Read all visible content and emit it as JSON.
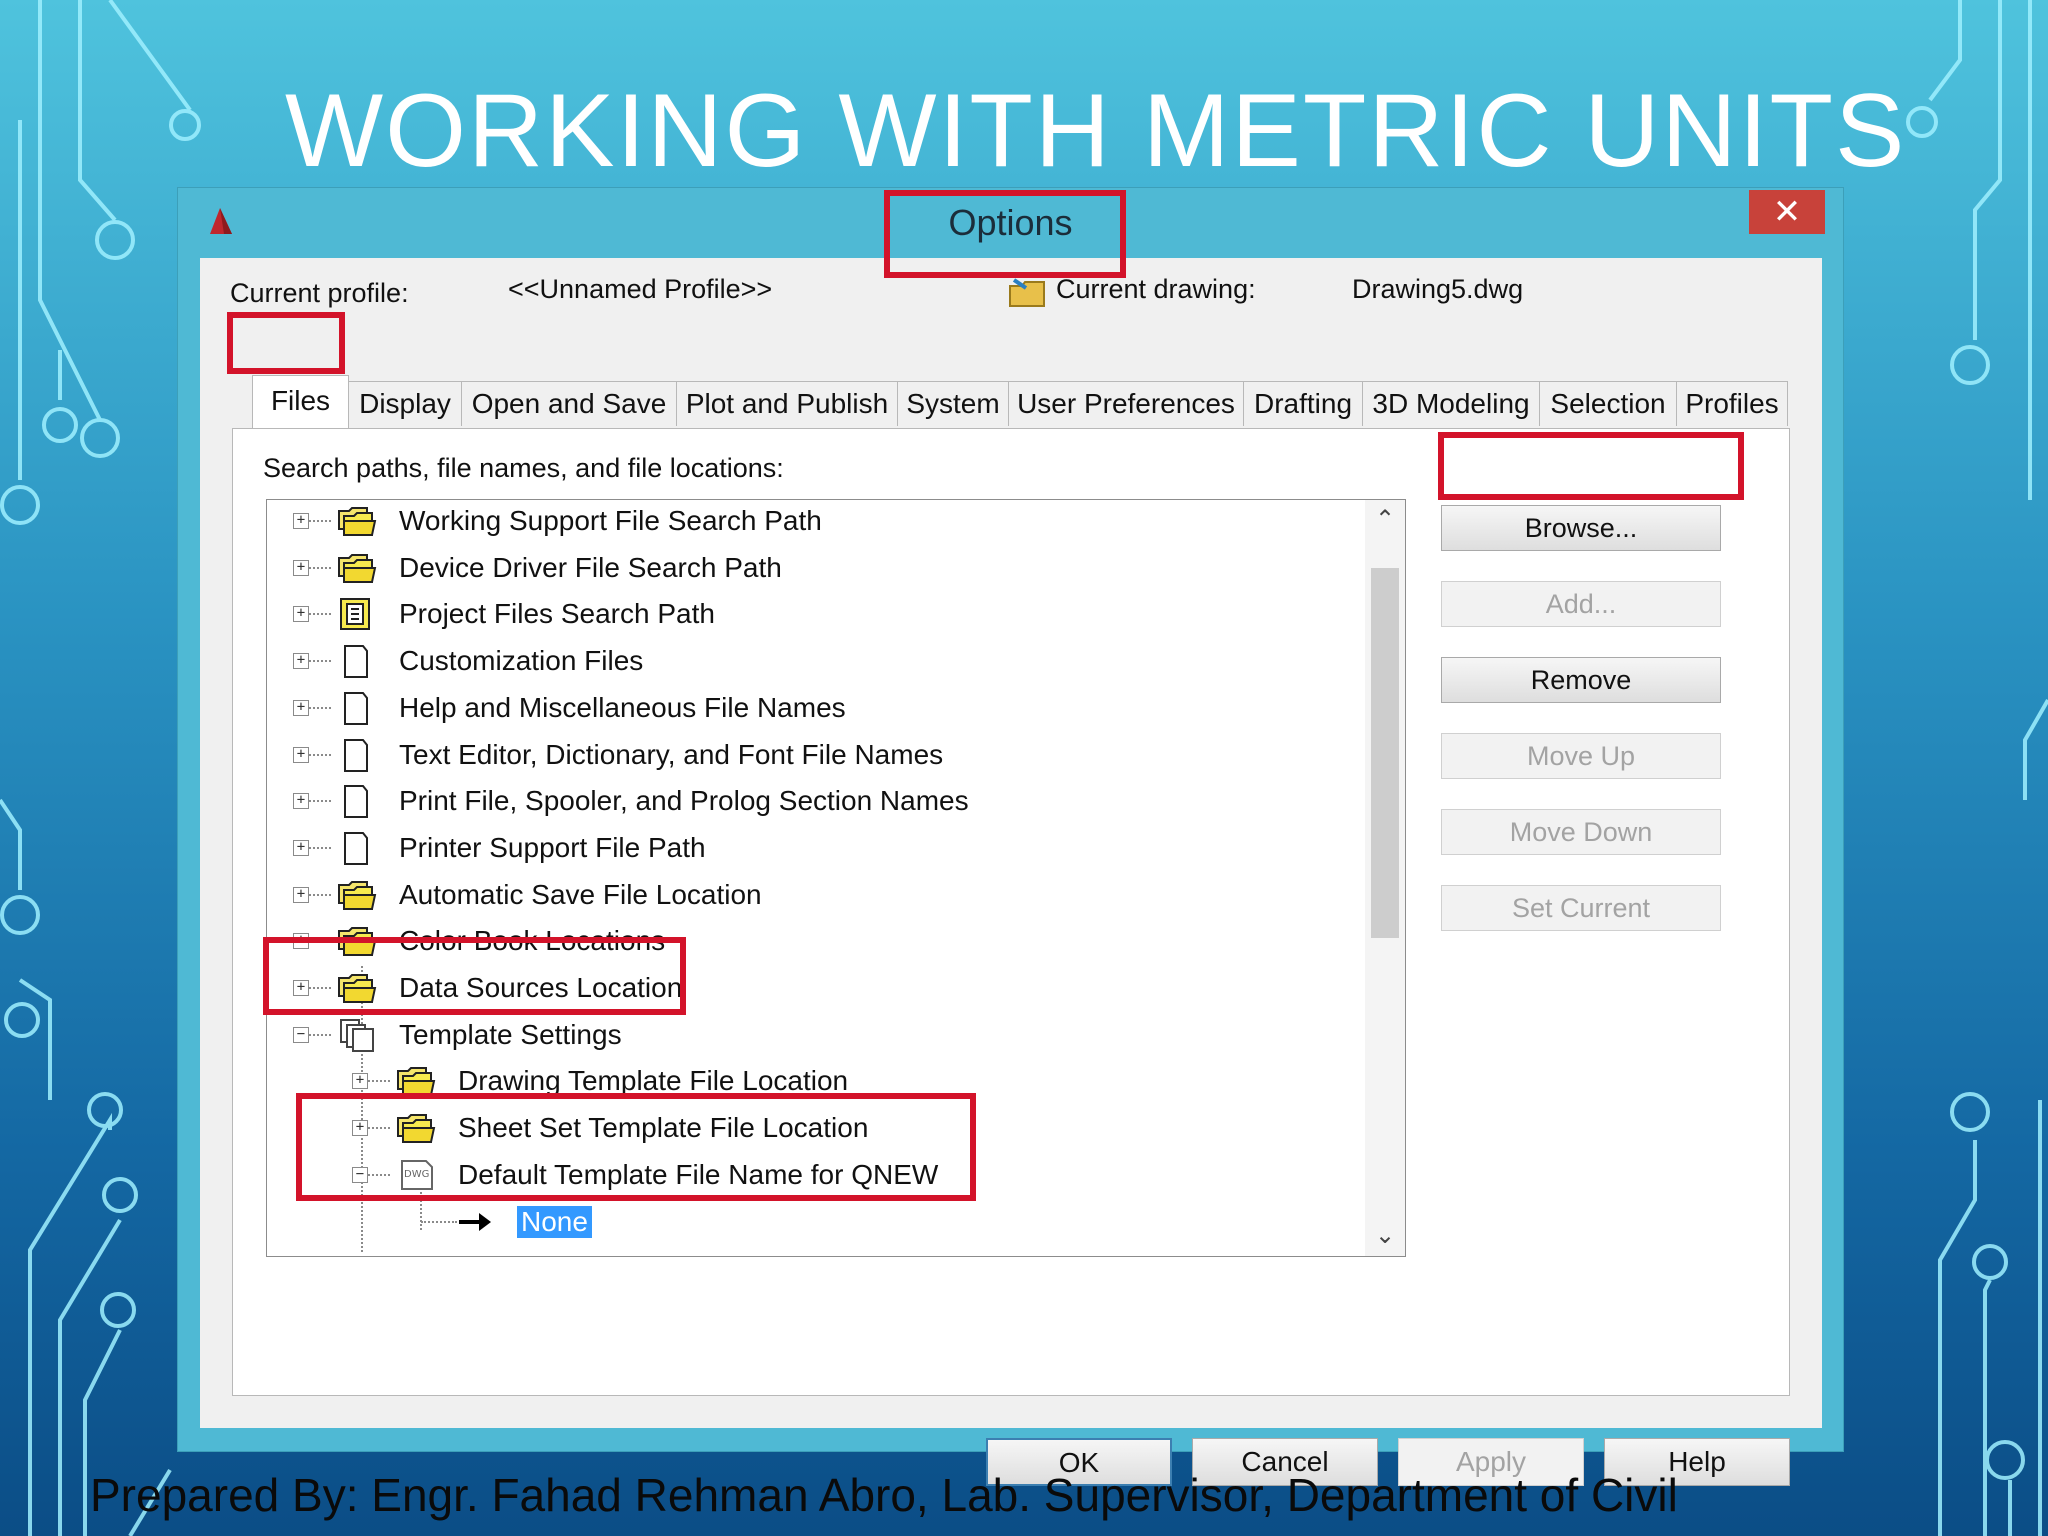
{
  "slide": {
    "title": "WORKING WITH METRIC UNITS",
    "footer": "Prepared By: Engr. Fahad Rehman Abro, Lab. Supervisor, Department of Civil"
  },
  "dialog": {
    "title": "Options",
    "close_glyph": "✕",
    "current_profile_label": "Current profile:",
    "current_profile_value": "<<Unnamed Profile>>",
    "current_drawing_label": "Current drawing:",
    "current_drawing_value": "Drawing5.dwg",
    "tabs": [
      {
        "label": "Files",
        "active": true
      },
      {
        "label": "Display"
      },
      {
        "label": "Open and Save"
      },
      {
        "label": "Plot and Publish"
      },
      {
        "label": "System"
      },
      {
        "label": "User Preferences"
      },
      {
        "label": "Drafting"
      },
      {
        "label": "3D Modeling"
      },
      {
        "label": "Selection"
      },
      {
        "label": "Profiles"
      }
    ],
    "panel_label": "Search paths, file names, and file locations:",
    "tree": [
      {
        "label": "Working Support File Search Path",
        "icon": "folders-icon",
        "expander": "+"
      },
      {
        "label": "Device Driver File Search Path",
        "icon": "folders-icon",
        "expander": "+"
      },
      {
        "label": "Project Files Search Path",
        "icon": "project-icon",
        "expander": "+"
      },
      {
        "label": "Customization Files",
        "icon": "page-icon",
        "expander": "+"
      },
      {
        "label": "Help and Miscellaneous File Names",
        "icon": "page-icon",
        "expander": "+"
      },
      {
        "label": "Text Editor, Dictionary, and Font File Names",
        "icon": "page-icon",
        "expander": "+"
      },
      {
        "label": "Print File, Spooler, and Prolog Section Names",
        "icon": "page-icon",
        "expander": "+"
      },
      {
        "label": "Printer Support File Path",
        "icon": "page-icon",
        "expander": "+"
      },
      {
        "label": "Automatic Save File Location",
        "icon": "folders-icon",
        "expander": "+"
      },
      {
        "label": "Color Book Locations",
        "icon": "folders-icon",
        "expander": "+"
      },
      {
        "label": "Data Sources Location",
        "icon": "folders-icon",
        "expander": "+"
      },
      {
        "label": "Template Settings",
        "icon": "template-icon",
        "expander": "−"
      },
      {
        "label": "Drawing Template File Location",
        "icon": "folders-icon",
        "expander": "+"
      },
      {
        "label": "Sheet Set Template File Location",
        "icon": "folders-icon",
        "expander": "+"
      },
      {
        "label": "Default Template File Name for QNEW",
        "icon": "dwg-file-icon",
        "expander": "−"
      },
      {
        "label": "None",
        "icon": "arrow-right-icon",
        "selected": true
      }
    ],
    "side_buttons": [
      {
        "label": "Browse...",
        "enabled": true
      },
      {
        "label": "Add...",
        "enabled": false
      },
      {
        "label": "Remove",
        "enabled": true
      },
      {
        "label": "Move Up",
        "enabled": false
      },
      {
        "label": "Move Down",
        "enabled": false
      },
      {
        "label": "Set Current",
        "enabled": false
      }
    ],
    "bottom_buttons": {
      "ok": "OK",
      "cancel": "Cancel",
      "apply": "Apply",
      "help": "Help"
    },
    "scroll_up_glyph": "⌃",
    "scroll_down_glyph": "⌄"
  },
  "colors": {
    "highlight": "#d3132a",
    "dialog_frame": "#4fb9d4",
    "selection": "#3399ff"
  }
}
